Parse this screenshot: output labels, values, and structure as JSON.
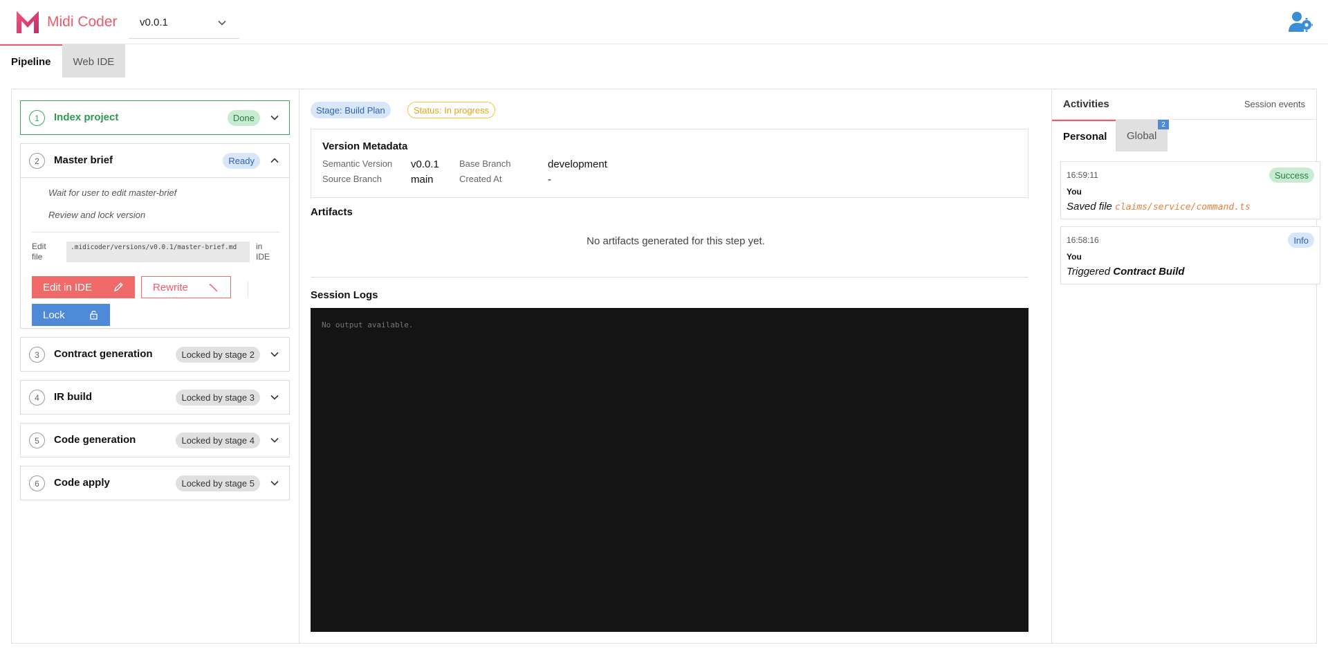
{
  "app": {
    "name": "Midi Coder",
    "version_selected": "v0.0.1"
  },
  "main_tabs": [
    {
      "label": "Pipeline",
      "active": true
    },
    {
      "label": "Web IDE",
      "active": false
    }
  ],
  "stages": [
    {
      "number": "1",
      "title": "Index project",
      "badge": "Done",
      "state": "done"
    },
    {
      "number": "2",
      "title": "Master brief",
      "badge": "Ready",
      "state": "expanded"
    },
    {
      "number": "3",
      "title": "Contract generation",
      "badge": "Locked by stage 2",
      "state": "locked"
    },
    {
      "number": "4",
      "title": "IR build",
      "badge": "Locked by stage 3",
      "state": "locked"
    },
    {
      "number": "5",
      "title": "Code generation",
      "badge": "Locked by stage 4",
      "state": "locked"
    },
    {
      "number": "6",
      "title": "Code apply",
      "badge": "Locked by stage 5",
      "state": "locked"
    }
  ],
  "master_brief": {
    "tasks": [
      "Wait for user to edit master-brief",
      "Review and lock version"
    ],
    "edit_label": "Edit file",
    "file_path": ".midicoder/versions/v0.0.1/master-brief.md",
    "in_ide_label": "in IDE",
    "edit_button": "Edit in IDE",
    "rewrite_button": "Rewrite",
    "lock_button": "Lock"
  },
  "center": {
    "stage_pill": "Stage: Build Plan",
    "status_pill": "Status: In progress",
    "metadata": {
      "title": "Version Metadata",
      "semantic_version_label": "Semantic Version",
      "semantic_version": "v0.0.1",
      "source_branch_label": "Source Branch",
      "source_branch": "main",
      "base_branch_label": "Base Branch",
      "base_branch": "development",
      "created_at_label": "Created At",
      "created_at": "-"
    },
    "artifacts_title": "Artifacts",
    "artifacts_empty": "No artifacts generated for this step yet.",
    "logs_title": "Session Logs",
    "logs_empty": "No output available."
  },
  "activities": {
    "title": "Activities",
    "subtitle": "Session events",
    "tabs": [
      {
        "label": "Personal",
        "active": true
      },
      {
        "label": "Global",
        "active": false,
        "count": "2"
      }
    ],
    "items": [
      {
        "time": "16:59:11",
        "status": "Success",
        "who": "You",
        "action": "Saved file",
        "target": "claims/service/command.ts"
      },
      {
        "time": "16:58:16",
        "status": "Info",
        "who": "You",
        "action": "Triggered",
        "target": "Contract Build"
      }
    ]
  },
  "colors": {
    "brand": "#ec5b6b",
    "done_green": "#3aa65b",
    "lock_blue": "#4f8ad8",
    "status_yellow": "#f5c23a"
  },
  "icons": {
    "logo": "midi-coder-logo",
    "user_settings": "user-gear-icon",
    "edit": "pencil-icon",
    "rewrite": "magic-wand-icon",
    "lock": "lock-icon"
  }
}
